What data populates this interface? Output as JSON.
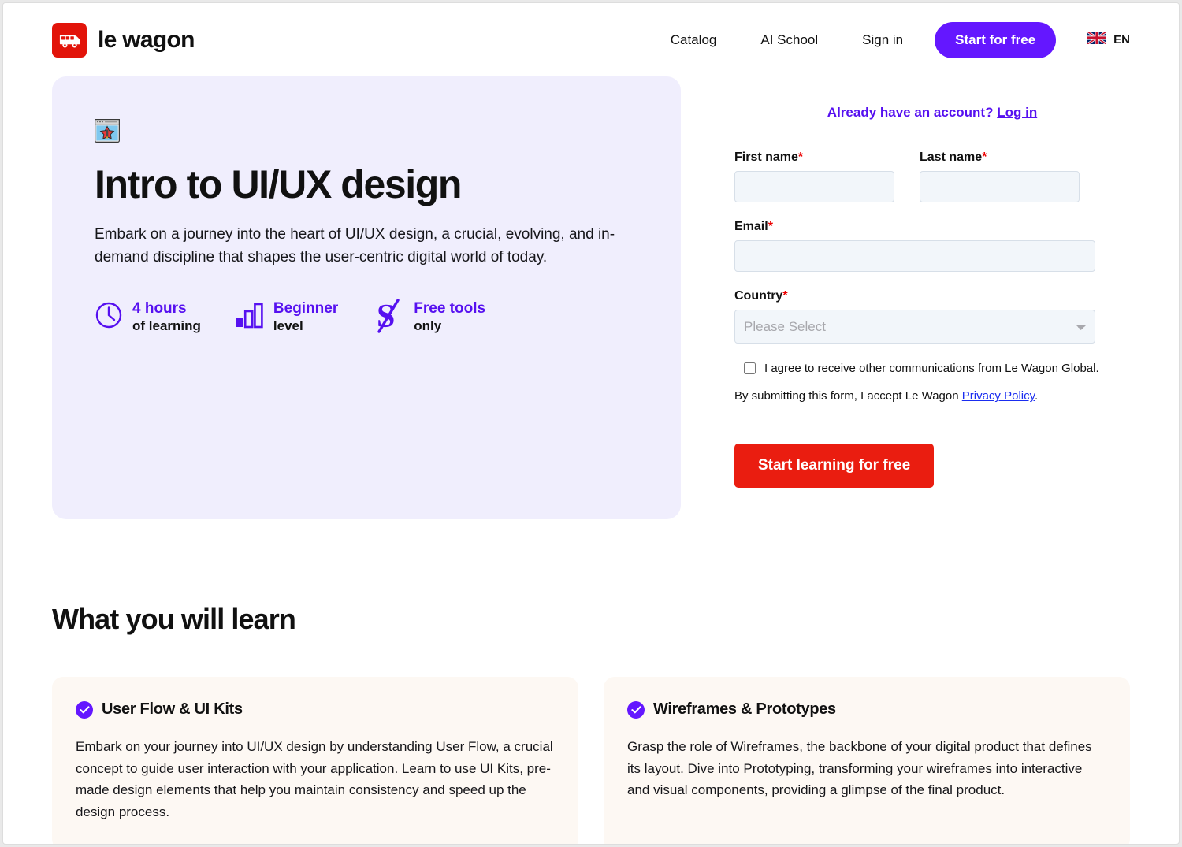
{
  "header": {
    "brand_name": "le wagon",
    "brand_icon": "wagon-bus-logo-icon",
    "nav": [
      {
        "label": "Catalog"
      },
      {
        "label": "AI School"
      },
      {
        "label": "Sign in"
      }
    ],
    "cta_label": "Start for free",
    "language": {
      "code": "EN",
      "flag": "uk-flag-icon"
    },
    "accent_purple": "#6417ff"
  },
  "hero": {
    "emoji_name": "browser-window-art-icon",
    "title": "Intro to UI/UX design",
    "description": "Embark on a journey into the heart of UI/UX design, a crucial, evolving, and in-demand discipline that shapes the user-centric digital world of today.",
    "background": "#f0eefd",
    "stats": [
      {
        "icon": "clock-icon",
        "main": "4 hours",
        "sub": "of learning"
      },
      {
        "icon": "bar-chart-icon",
        "main": "Beginner",
        "sub": "level"
      },
      {
        "icon": "dollar-crossed-icon",
        "main": "Free tools",
        "sub": "only"
      }
    ]
  },
  "form": {
    "account_prompt": "Already have an account?",
    "login_label": "Log in",
    "fields": {
      "first_name": {
        "label": "First name",
        "required": "*",
        "value": "",
        "placeholder": ""
      },
      "last_name": {
        "label": "Last name",
        "required": "*",
        "value": "",
        "placeholder": ""
      },
      "email": {
        "label": "Email",
        "required": "*",
        "value": "",
        "placeholder": ""
      },
      "country": {
        "label": "Country",
        "required": "*",
        "selected": "Please Select"
      }
    },
    "country_options": [
      "Please Select"
    ],
    "consent_label": "I agree to receive other communications from Le Wagon Global.",
    "consent_checked": false,
    "legal_prefix": "By submitting this form, I accept Le Wagon ",
    "legal_link": "Privacy Policy",
    "legal_suffix": ".",
    "submit_label": "Start learning for free",
    "submit_color": "#ea1d10"
  },
  "learn": {
    "heading": "What you will learn",
    "card_background": "#fdf8f3",
    "cards": [
      {
        "icon": "check-circle-icon",
        "title": "User Flow & UI Kits",
        "body": "Embark on your journey into UI/UX design by understanding User Flow, a crucial concept to guide user interaction with your application. Learn to use UI Kits, pre-made design elements that help you maintain consistency and speed up the design process."
      },
      {
        "icon": "check-circle-icon",
        "title": "Wireframes & Prototypes",
        "body": "Grasp the role of Wireframes, the backbone of your digital product that defines its layout. Dive into Prototyping, transforming your wireframes into interactive and visual components, providing a glimpse of the final product."
      }
    ]
  }
}
